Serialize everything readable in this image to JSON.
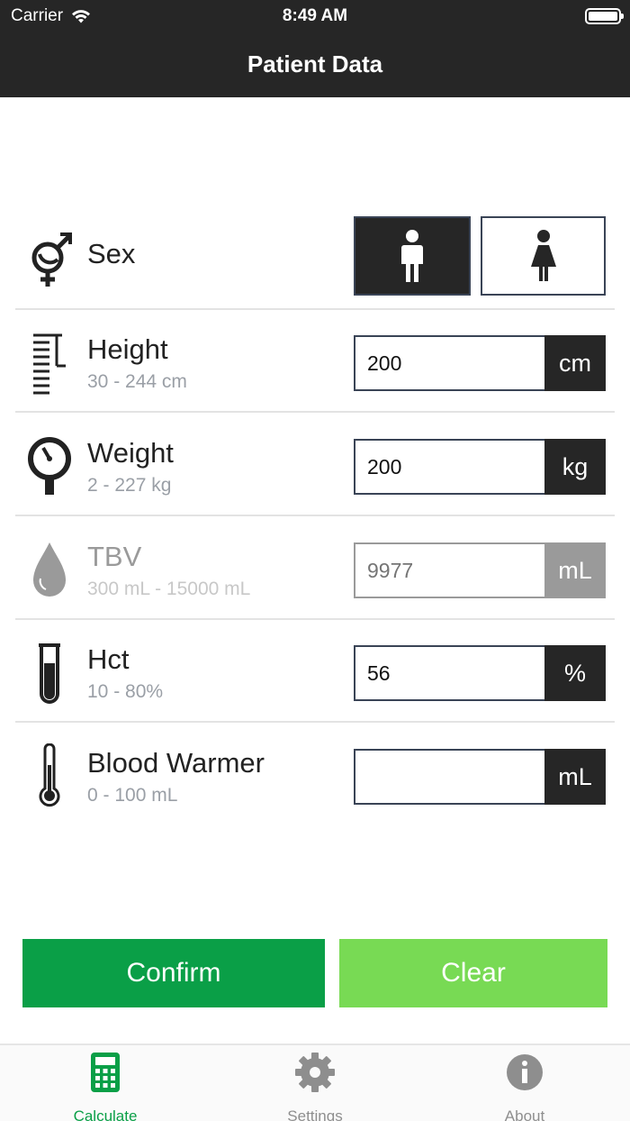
{
  "status_bar": {
    "carrier": "Carrier",
    "time": "8:49 AM"
  },
  "nav": {
    "title": "Patient Data"
  },
  "sex": {
    "label": "Sex",
    "selected": "male"
  },
  "fields": {
    "height": {
      "label": "Height",
      "range": "30 - 244 cm",
      "value": "200",
      "unit": "cm"
    },
    "weight": {
      "label": "Weight",
      "range": "2 - 227 kg",
      "value": "200",
      "unit": "kg"
    },
    "tbv": {
      "label": "TBV",
      "range": "300 mL - 15000 mL",
      "placeholder": "9977",
      "unit": "mL",
      "disabled": true
    },
    "hct": {
      "label": "Hct",
      "range": "10 - 80%",
      "value": "56",
      "unit": "%"
    },
    "blood_warmer": {
      "label": "Blood Warmer",
      "range": "0 - 100 mL",
      "value": "",
      "unit": "mL"
    }
  },
  "actions": {
    "confirm": "Confirm",
    "clear": "Clear"
  },
  "tabs": [
    {
      "label": "Calculate",
      "icon": "calculator-icon",
      "active": true
    },
    {
      "label": "Settings",
      "icon": "gear-icon",
      "active": false
    },
    {
      "label": "About",
      "icon": "info-icon",
      "active": false
    }
  ],
  "colors": {
    "primary": "#0a9f47",
    "secondary": "#78da54",
    "dark": "#262626"
  }
}
